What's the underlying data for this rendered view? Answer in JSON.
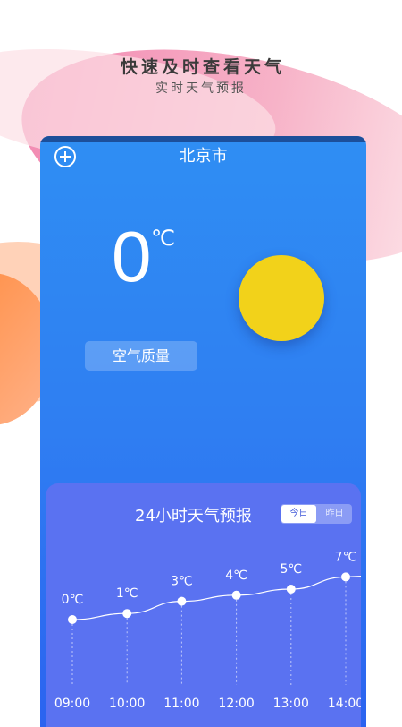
{
  "promo": {
    "title": "快速及时查看天气",
    "subtitle": "实时天气预报"
  },
  "header": {
    "city": "北京市",
    "add_icon": "plus-circle-icon"
  },
  "current": {
    "temperature": "0",
    "unit": "℃",
    "weather_icon": "sun-icon",
    "air_quality_label": "空气质量"
  },
  "forecast": {
    "title": "24小时天气预报",
    "toggle": {
      "today": "今日",
      "yesterday": "昨日",
      "selected": "today"
    }
  },
  "chart_data": {
    "type": "line",
    "categories": [
      "09:00",
      "10:00",
      "11:00",
      "12:00",
      "13:00",
      "14:00"
    ],
    "series": [
      {
        "values": [
          0,
          1,
          3,
          4,
          5,
          7
        ]
      }
    ],
    "value_labels": [
      "0℃",
      "1℃",
      "3℃",
      "4℃",
      "5℃",
      "7℃"
    ],
    "title": "24小时天气预报",
    "xlabel": "",
    "ylabel": "",
    "grid": false
  },
  "colors": {
    "panel_top": "#2f8ef3",
    "panel_bottom": "#2b63f0",
    "forecast_card": "#5a72f1",
    "sun": "#f2d21a"
  }
}
